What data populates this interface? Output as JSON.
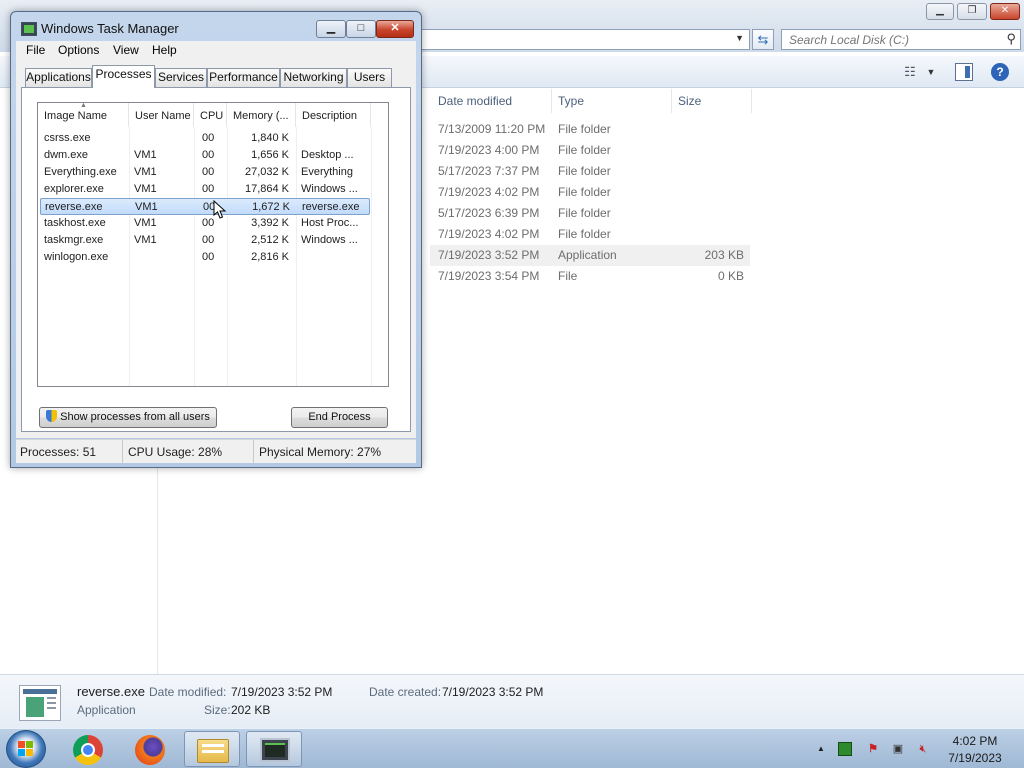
{
  "explorer": {
    "search_placeholder": "Search Local Disk (C:)",
    "columns": [
      "Date modified",
      "Type",
      "Size"
    ],
    "files": [
      {
        "date": "7/13/2009 11:20 PM",
        "type": "File folder",
        "size": ""
      },
      {
        "date": "7/19/2023 4:00 PM",
        "type": "File folder",
        "size": ""
      },
      {
        "date": "5/17/2023 7:37 PM",
        "type": "File folder",
        "size": ""
      },
      {
        "date": "7/19/2023 4:02 PM",
        "type": "File folder",
        "size": ""
      },
      {
        "date": "5/17/2023 6:39 PM",
        "type": "File folder",
        "size": ""
      },
      {
        "date": "7/19/2023 4:02 PM",
        "type": "File folder",
        "size": ""
      },
      {
        "date": "7/19/2023 3:52 PM",
        "type": "Application",
        "size": "203 KB"
      },
      {
        "date": "7/19/2023 3:54 PM",
        "type": "File",
        "size": "0 KB"
      }
    ],
    "details": {
      "name": "reverse.exe",
      "type": "Application",
      "date_modified_label": "Date modified:",
      "date_modified": "7/19/2023 3:52 PM",
      "date_created_label": "Date created:",
      "date_created": "7/19/2023 3:52 PM",
      "size_label": "Size:",
      "size": "202 KB"
    }
  },
  "taskmgr": {
    "title": "Windows Task Manager",
    "menu": [
      "File",
      "Options",
      "View",
      "Help"
    ],
    "tabs": [
      "Applications",
      "Processes",
      "Services",
      "Performance",
      "Networking",
      "Users"
    ],
    "active_tab": "Processes",
    "columns": [
      "Image Name",
      "User Name",
      "CPU",
      "Memory (...",
      "Description"
    ],
    "processes": [
      {
        "name": "csrss.exe",
        "user": "",
        "cpu": "00",
        "mem": "1,840 K",
        "desc": ""
      },
      {
        "name": "dwm.exe",
        "user": "VM1",
        "cpu": "00",
        "mem": "1,656 K",
        "desc": "Desktop ..."
      },
      {
        "name": "Everything.exe",
        "user": "VM1",
        "cpu": "00",
        "mem": "27,032 K",
        "desc": "Everything"
      },
      {
        "name": "explorer.exe",
        "user": "VM1",
        "cpu": "00",
        "mem": "17,864 K",
        "desc": "Windows ..."
      },
      {
        "name": "reverse.exe",
        "user": "VM1",
        "cpu": "00",
        "mem": "1,672 K",
        "desc": "reverse.exe"
      },
      {
        "name": "taskhost.exe",
        "user": "VM1",
        "cpu": "00",
        "mem": "3,392 K",
        "desc": "Host Proc..."
      },
      {
        "name": "taskmgr.exe",
        "user": "VM1",
        "cpu": "00",
        "mem": "2,512 K",
        "desc": "Windows ..."
      },
      {
        "name": "winlogon.exe",
        "user": "",
        "cpu": "00",
        "mem": "2,816 K",
        "desc": ""
      }
    ],
    "selected_process": "reverse.exe",
    "show_all_label": "Show processes from all users",
    "end_process_label": "End Process",
    "status": {
      "processes": "Processes: 51",
      "cpu": "CPU Usage: 28%",
      "memory": "Physical Memory: 27%"
    }
  },
  "taskbar": {
    "pinned": [
      "chrome-icon",
      "firefox-icon",
      "explorer-folder-icon",
      "task-manager-icon"
    ],
    "time": "4:02 PM",
    "date": "7/19/2023"
  },
  "colors": {
    "selection": "#c1dbfc",
    "close_red": "#c8442c",
    "taskbar": "#9fb8d4"
  }
}
